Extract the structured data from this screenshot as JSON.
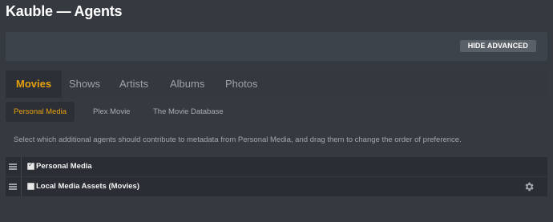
{
  "page": {
    "title": "Kauble — Agents"
  },
  "advanced": {
    "hide_label": "HIDE ADVANCED"
  },
  "tabs": [
    {
      "label": "Movies",
      "active": true
    },
    {
      "label": "Shows",
      "active": false
    },
    {
      "label": "Artists",
      "active": false
    },
    {
      "label": "Albums",
      "active": false
    },
    {
      "label": "Photos",
      "active": false
    }
  ],
  "subtabs": [
    {
      "label": "Personal Media",
      "active": true
    },
    {
      "label": "Plex Movie",
      "active": false
    },
    {
      "label": "The Movie Database",
      "active": false
    }
  ],
  "description": "Select which additional agents should contribute to metadata from Personal Media, and drag them to change the order of preference.",
  "agents": [
    {
      "label": "Personal Media",
      "checked": true,
      "has_settings": false
    },
    {
      "label": "Local Media Assets (Movies)",
      "checked": false,
      "has_settings": true
    }
  ],
  "colors": {
    "accent": "#e5a00d",
    "background": "#353a41",
    "row_background": "#2a2e34"
  },
  "icons": {
    "drag": "drag-handle-icon",
    "settings": "gear-icon",
    "checkbox": "checkbox-icon"
  }
}
